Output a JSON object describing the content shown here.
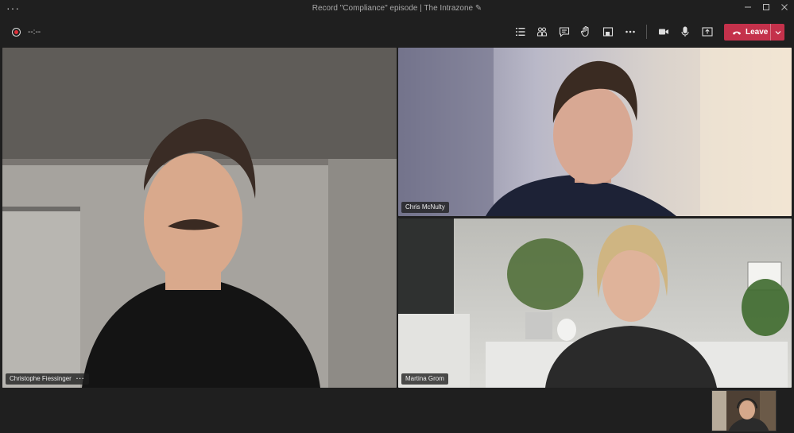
{
  "window": {
    "title": "Record \"Compliance\" episode | The Intrazone ✎",
    "menu_icon": "ellipsis-icon",
    "controls": [
      "minimize-icon",
      "maximize-icon",
      "close-icon"
    ]
  },
  "toolbar": {
    "record_icon": "record-icon",
    "timer": "--:--",
    "buttons": [
      "show-conversation-list-icon",
      "participants-icon",
      "chat-icon",
      "raise-hand-icon",
      "share-tray-icon",
      "more-actions-icon",
      "camera-icon",
      "microphone-icon",
      "share-screen-icon"
    ],
    "leave_label": "Leave",
    "colors": {
      "leave": "#c4314b",
      "record": "#e0303a"
    }
  },
  "participants": [
    {
      "name": "Christophe Fiessinger",
      "more": "···"
    },
    {
      "name": "Chris McNulty"
    },
    {
      "name": "Martina Grom"
    }
  ]
}
